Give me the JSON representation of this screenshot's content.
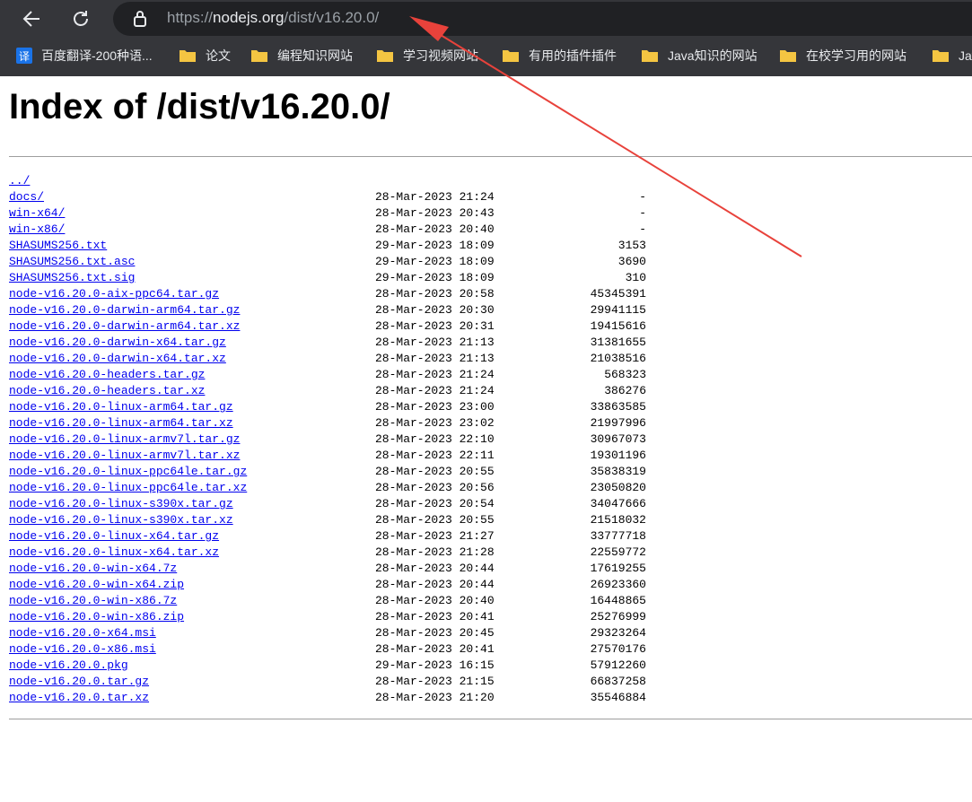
{
  "browser": {
    "url_proto": "https://",
    "url_host": "nodejs.org",
    "url_path": "/dist/v16.20.0/",
    "bookmarks": [
      {
        "label": "百度翻译-200种语...",
        "icon": "translate-icon"
      },
      {
        "label": "论文",
        "icon": "folder-icon"
      },
      {
        "label": "编程知识网站",
        "icon": "folder-icon"
      },
      {
        "label": "学习视频网站",
        "icon": "folder-icon"
      },
      {
        "label": "有用的插件插件",
        "icon": "folder-icon"
      },
      {
        "label": "Java知识的网站",
        "icon": "folder-icon"
      },
      {
        "label": "在校学习用的网站",
        "icon": "folder-icon"
      },
      {
        "label": "Jav",
        "icon": "folder-icon"
      }
    ],
    "translate_glyph": "译"
  },
  "page": {
    "title": "Index of /dist/v16.20.0/",
    "parent_link": "../",
    "entries": [
      {
        "name": "docs/",
        "date": "28-Mar-2023 21:24",
        "size": "-"
      },
      {
        "name": "win-x64/",
        "date": "28-Mar-2023 20:43",
        "size": "-"
      },
      {
        "name": "win-x86/",
        "date": "28-Mar-2023 20:40",
        "size": "-"
      },
      {
        "name": "SHASUMS256.txt",
        "date": "29-Mar-2023 18:09",
        "size": "3153"
      },
      {
        "name": "SHASUMS256.txt.asc",
        "date": "29-Mar-2023 18:09",
        "size": "3690"
      },
      {
        "name": "SHASUMS256.txt.sig",
        "date": "29-Mar-2023 18:09",
        "size": "310"
      },
      {
        "name": "node-v16.20.0-aix-ppc64.tar.gz",
        "date": "28-Mar-2023 20:58",
        "size": "45345391"
      },
      {
        "name": "node-v16.20.0-darwin-arm64.tar.gz",
        "date": "28-Mar-2023 20:30",
        "size": "29941115"
      },
      {
        "name": "node-v16.20.0-darwin-arm64.tar.xz",
        "date": "28-Mar-2023 20:31",
        "size": "19415616"
      },
      {
        "name": "node-v16.20.0-darwin-x64.tar.gz",
        "date": "28-Mar-2023 21:13",
        "size": "31381655"
      },
      {
        "name": "node-v16.20.0-darwin-x64.tar.xz",
        "date": "28-Mar-2023 21:13",
        "size": "21038516"
      },
      {
        "name": "node-v16.20.0-headers.tar.gz",
        "date": "28-Mar-2023 21:24",
        "size": "568323"
      },
      {
        "name": "node-v16.20.0-headers.tar.xz",
        "date": "28-Mar-2023 21:24",
        "size": "386276"
      },
      {
        "name": "node-v16.20.0-linux-arm64.tar.gz",
        "date": "28-Mar-2023 23:00",
        "size": "33863585"
      },
      {
        "name": "node-v16.20.0-linux-arm64.tar.xz",
        "date": "28-Mar-2023 23:02",
        "size": "21997996"
      },
      {
        "name": "node-v16.20.0-linux-armv7l.tar.gz",
        "date": "28-Mar-2023 22:10",
        "size": "30967073"
      },
      {
        "name": "node-v16.20.0-linux-armv7l.tar.xz",
        "date": "28-Mar-2023 22:11",
        "size": "19301196"
      },
      {
        "name": "node-v16.20.0-linux-ppc64le.tar.gz",
        "date": "28-Mar-2023 20:55",
        "size": "35838319"
      },
      {
        "name": "node-v16.20.0-linux-ppc64le.tar.xz",
        "date": "28-Mar-2023 20:56",
        "size": "23050820"
      },
      {
        "name": "node-v16.20.0-linux-s390x.tar.gz",
        "date": "28-Mar-2023 20:54",
        "size": "34047666"
      },
      {
        "name": "node-v16.20.0-linux-s390x.tar.xz",
        "date": "28-Mar-2023 20:55",
        "size": "21518032"
      },
      {
        "name": "node-v16.20.0-linux-x64.tar.gz",
        "date": "28-Mar-2023 21:27",
        "size": "33777718"
      },
      {
        "name": "node-v16.20.0-linux-x64.tar.xz",
        "date": "28-Mar-2023 21:28",
        "size": "22559772"
      },
      {
        "name": "node-v16.20.0-win-x64.7z",
        "date": "28-Mar-2023 20:44",
        "size": "17619255"
      },
      {
        "name": "node-v16.20.0-win-x64.zip",
        "date": "28-Mar-2023 20:44",
        "size": "26923360"
      },
      {
        "name": "node-v16.20.0-win-x86.7z",
        "date": "28-Mar-2023 20:40",
        "size": "16448865"
      },
      {
        "name": "node-v16.20.0-win-x86.zip",
        "date": "28-Mar-2023 20:41",
        "size": "25276999"
      },
      {
        "name": "node-v16.20.0-x64.msi",
        "date": "28-Mar-2023 20:45",
        "size": "29323264"
      },
      {
        "name": "node-v16.20.0-x86.msi",
        "date": "28-Mar-2023 20:41",
        "size": "27570176"
      },
      {
        "name": "node-v16.20.0.pkg",
        "date": "29-Mar-2023 16:15",
        "size": "57912260"
      },
      {
        "name": "node-v16.20.0.tar.gz",
        "date": "28-Mar-2023 21:15",
        "size": "66837258"
      },
      {
        "name": "node-v16.20.0.tar.xz",
        "date": "28-Mar-2023 21:20",
        "size": "35546884"
      }
    ]
  },
  "annotation": {
    "arrow_color": "#e8423b"
  },
  "colors": {
    "link": "#0000ee",
    "chrome_dark": "#35363a",
    "omnibox": "#202124"
  }
}
